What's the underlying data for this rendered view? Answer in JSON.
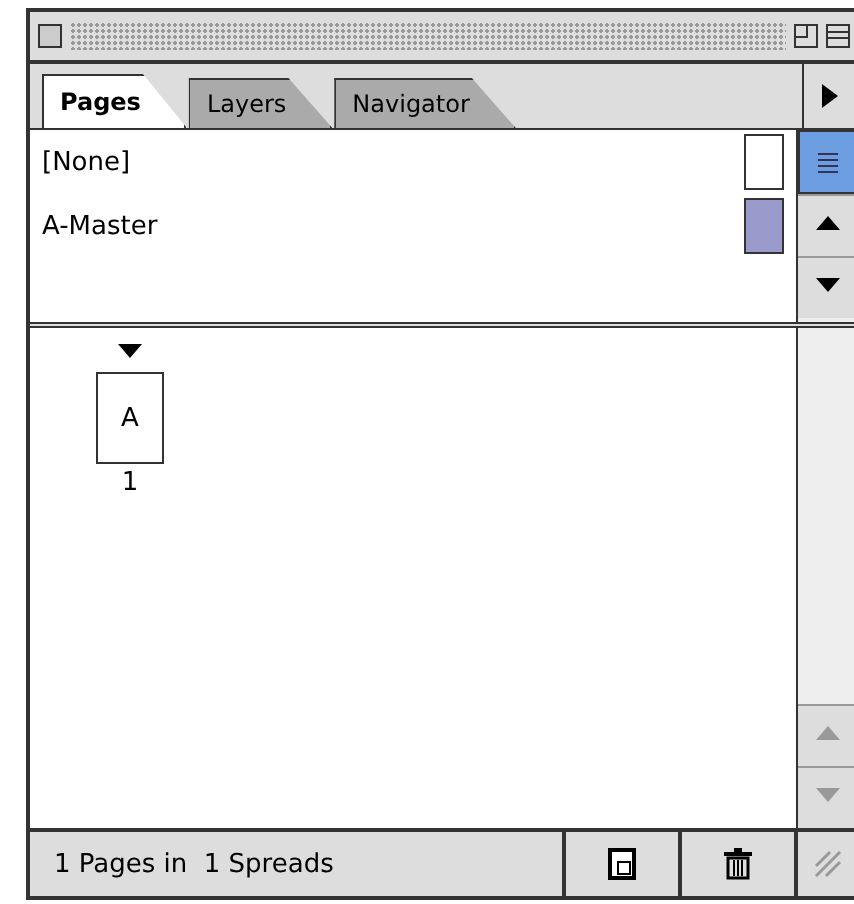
{
  "tabs": [
    {
      "label": "Pages",
      "selected": true
    },
    {
      "label": "Layers",
      "selected": false
    },
    {
      "label": "Navigator",
      "selected": false
    }
  ],
  "masters": [
    {
      "name": "[None]",
      "color": "#ffffff"
    },
    {
      "name": "A-Master",
      "color": "#9999cc"
    }
  ],
  "pages": [
    {
      "master_letter": "A",
      "number": "1"
    }
  ],
  "status_bar": {
    "text": "1 Pages in  1 Spreads"
  }
}
